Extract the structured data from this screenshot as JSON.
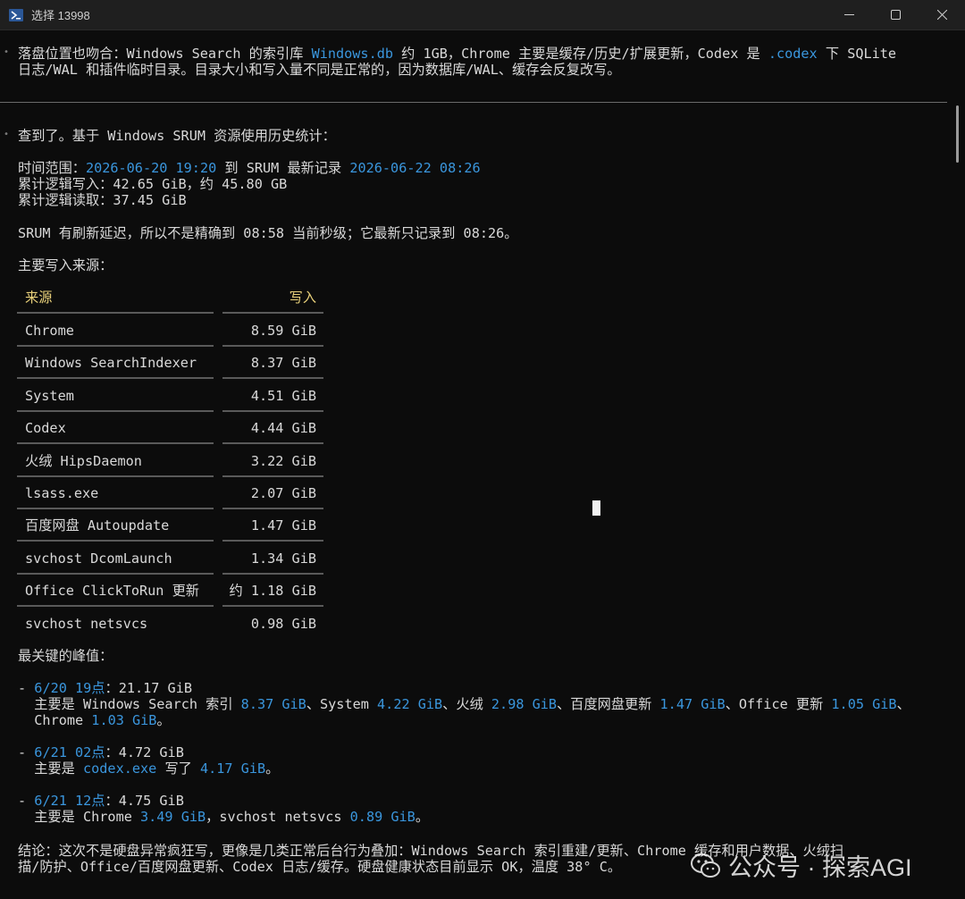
{
  "window": {
    "title": "选择 13998"
  },
  "top_block": [
    {
      "segs": [
        {
          "t": "落盘位置也吻合：Windows Search 的索引库 "
        },
        {
          "t": "Windows.db",
          "c": "blue"
        },
        {
          "t": " 约 1GB，Chrome 主要是缓存/历史/扩展更新，Codex 是 "
        },
        {
          "t": ".codex",
          "c": "blue"
        },
        {
          "t": " 下 SQLite"
        }
      ]
    },
    {
      "segs": [
        {
          "t": "日志/WAL 和插件临时目录。目录大小和写入量不同是正常的，因为数据库/WAL、缓存会反复改写。"
        }
      ]
    }
  ],
  "summary": {
    "intro": "查到了。基于 Windows SRUM 资源使用历史统计：",
    "range_label": "时间范围：",
    "range_start": "2026-06-20 19:20",
    "range_mid": " 到 SRUM 最新记录 ",
    "range_end": "2026-06-22 08:26",
    "write_total": "累计逻辑写入：42.65 GiB，约 45.80 GB",
    "read_total": "累计逻辑读取：37.45 GiB",
    "delay_note": "SRUM 有刷新延迟，所以不是精确到 08:58 当前秒级；它最新只记录到 08:26。",
    "sources_heading": "主要写入来源："
  },
  "table": {
    "headers": [
      "来源",
      "写入"
    ],
    "rows": [
      [
        "Chrome",
        "8.59 GiB"
      ],
      [
        "Windows SearchIndexer",
        "8.37 GiB"
      ],
      [
        "System",
        "4.51 GiB"
      ],
      [
        "Codex",
        "4.44 GiB"
      ],
      [
        "火绒 HipsDaemon",
        "3.22 GiB"
      ],
      [
        "lsass.exe",
        "2.07 GiB"
      ],
      [
        "百度网盘 Autoupdate",
        "1.47 GiB"
      ],
      [
        "svchost DcomLaunch",
        "1.34 GiB"
      ],
      [
        "Office ClickToRun 更新",
        "约 1.18 GiB"
      ],
      [
        "svchost netsvcs",
        "0.98 GiB"
      ]
    ]
  },
  "peaks_heading": "最关键的峰值：",
  "peaks": [
    {
      "head": [
        {
          "t": "- "
        },
        {
          "t": "6/20 19点",
          "c": "blue"
        },
        {
          "t": "：21.17 GiB"
        }
      ],
      "lines": [
        [
          {
            "t": "  主要是 Windows Search 索引 "
          },
          {
            "t": "8.37 GiB",
            "c": "blue"
          },
          {
            "t": "、System "
          },
          {
            "t": "4.22 GiB",
            "c": "blue"
          },
          {
            "t": "、火绒 "
          },
          {
            "t": "2.98 GiB",
            "c": "blue"
          },
          {
            "t": "、百度网盘更新 "
          },
          {
            "t": "1.47 GiB",
            "c": "blue"
          },
          {
            "t": "、Office 更新 "
          },
          {
            "t": "1.05 GiB",
            "c": "blue"
          },
          {
            "t": "、"
          }
        ],
        [
          {
            "t": "  Chrome "
          },
          {
            "t": "1.03 GiB",
            "c": "blue"
          },
          {
            "t": "。"
          }
        ]
      ]
    },
    {
      "head": [
        {
          "t": "- "
        },
        {
          "t": "6/21 02点",
          "c": "blue"
        },
        {
          "t": "：4.72 GiB"
        }
      ],
      "lines": [
        [
          {
            "t": "  主要是 "
          },
          {
            "t": "codex.exe",
            "c": "blue"
          },
          {
            "t": " 写了 "
          },
          {
            "t": "4.17 GiB",
            "c": "blue"
          },
          {
            "t": "。"
          }
        ]
      ]
    },
    {
      "head": [
        {
          "t": "- "
        },
        {
          "t": "6/21 12点",
          "c": "blue"
        },
        {
          "t": "：4.75 GiB"
        }
      ],
      "lines": [
        [
          {
            "t": "  主要是 Chrome "
          },
          {
            "t": "3.49 GiB",
            "c": "blue"
          },
          {
            "t": "，svchost netsvcs "
          },
          {
            "t": "0.89 GiB",
            "c": "blue"
          },
          {
            "t": "。"
          }
        ]
      ]
    }
  ],
  "conclusion": [
    "结论：这次不是硬盘异常疯狂写，更像是几类正常后台行为叠加：Windows Search 索引重建/更新、Chrome 缓存和用户数据、火绒扫",
    "描/防护、Office/百度网盘更新、Codex 日志/缓存。硬盘健康状态目前显示 OK，温度 38° C。"
  ],
  "watermark": "公众号 · 探索AGI",
  "colors": {
    "accent_blue": "#3a96dd",
    "header_yellow": "#e8d07a",
    "background": "#0c0c0c"
  }
}
